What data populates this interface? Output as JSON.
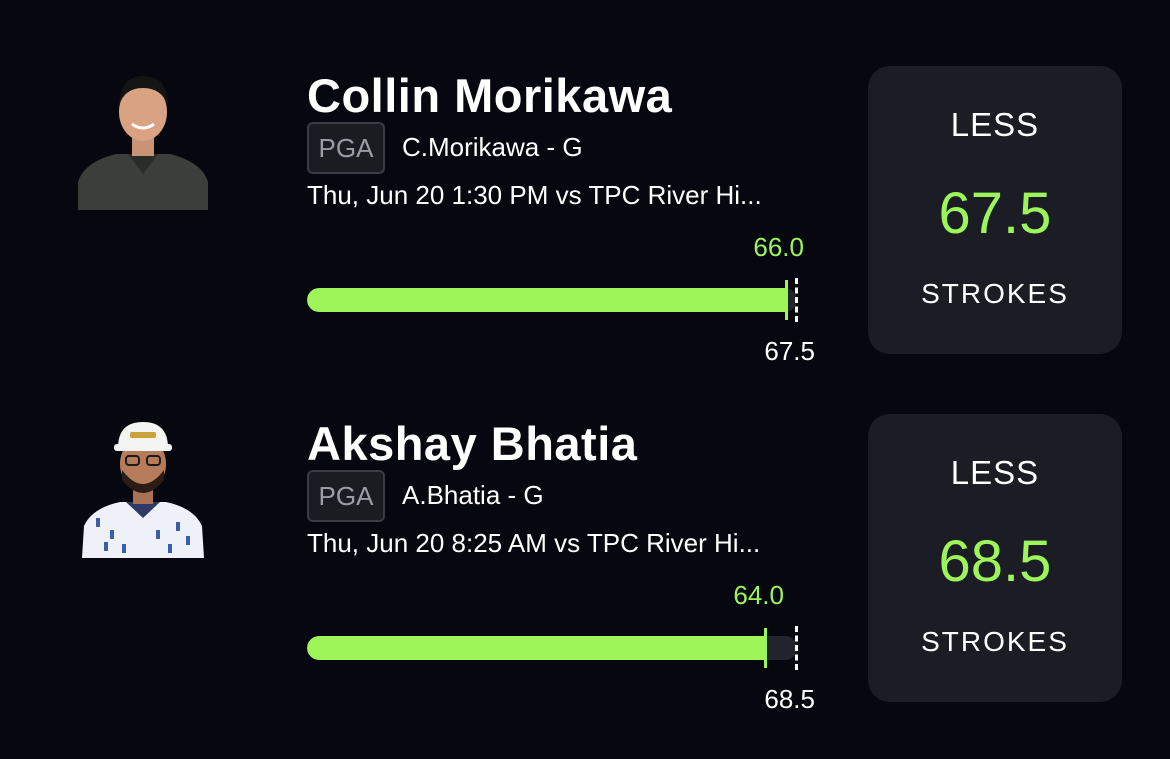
{
  "colors": {
    "background": "#07080f",
    "accent": "#9cf65a",
    "card": "#1b1c24",
    "track": "#22242d"
  },
  "picks": [
    {
      "player_name": "Collin Morikawa",
      "league": "PGA",
      "short_name": "C.Morikawa - G",
      "game_info": "Thu, Jun 20 1:30 PM  vs TPC River Hi...",
      "projection": "66.0",
      "projection_fraction": 0.977,
      "line_label": "67.5",
      "direction": "LESS",
      "line_value": "67.5",
      "stat_type": "STROKES",
      "avatar_icon": "player-headshot-icon"
    },
    {
      "player_name": "Akshay Bhatia",
      "league": "PGA",
      "short_name": "A.Bhatia - G",
      "game_info": "Thu, Jun 20 8:25 AM  vs TPC River Hi...",
      "projection": "64.0",
      "projection_fraction": 0.934,
      "line_label": "68.5",
      "direction": "LESS",
      "line_value": "68.5",
      "stat_type": "STROKES",
      "avatar_icon": "player-headshot-icon"
    }
  ]
}
